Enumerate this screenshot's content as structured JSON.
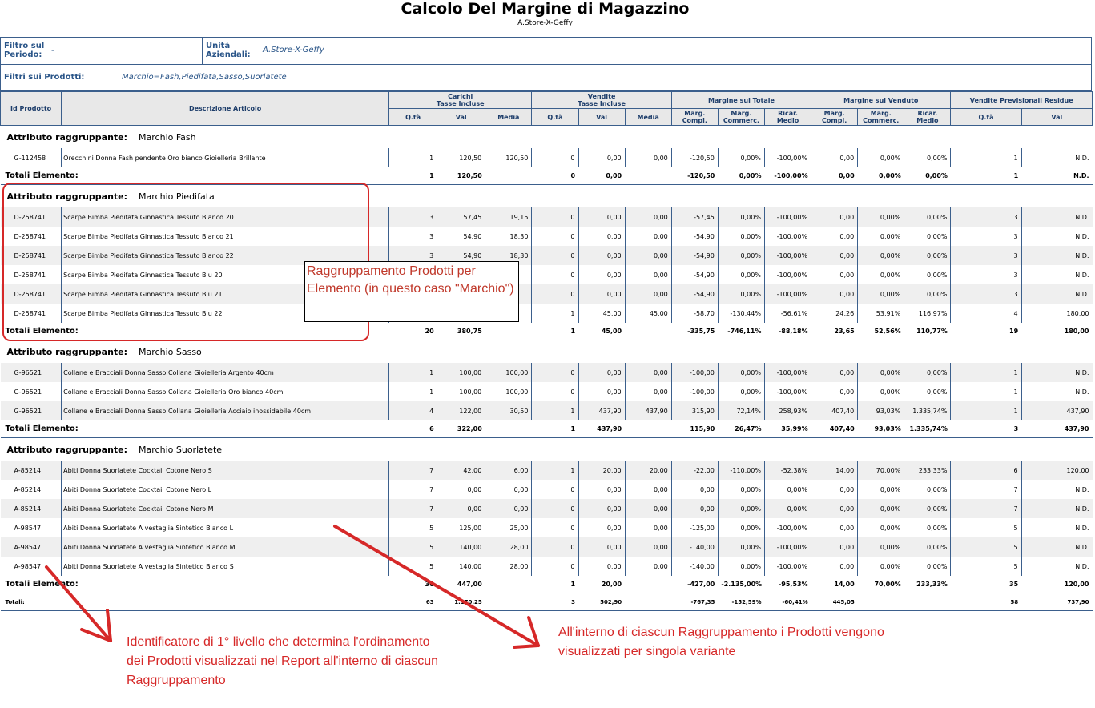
{
  "header": {
    "title": "Calcolo Del Margine di Magazzino",
    "subtitle": "A.Store-X-Geffy"
  },
  "filters": {
    "period_label": "Filtro sul Periodo:",
    "period_value": "-",
    "unit_label": "Unità Aziendali:",
    "unit_value": "A.Store-X-Geffy",
    "products_label": "Filtri sui Prodotti:",
    "products_value": "Marchio=Fash,Piedifata,Sasso,Suorlatete"
  },
  "columns": {
    "id": "Id Prodotto",
    "desc": "Descrizione Articolo",
    "carichi": "Carichi\nTasse Incluse",
    "vendite": "Vendite\nTasse Incluse",
    "marg_tot": "Margine sul Totale",
    "marg_vend": "Margine sul Venduto",
    "prev": "Vendite Previsionali Residue",
    "qta": "Q.tà",
    "val": "Val",
    "media": "Media",
    "marg_compl": "Marg.\nCompl.",
    "marg_comm": "Marg.\nCommerc.",
    "ricar": "Ricar. Medio"
  },
  "group_label": "Attributo raggruppante:",
  "totals_label": "Totali Elemento:",
  "grand_label": "Totali:",
  "groups": [
    {
      "name": "Marchio Fash",
      "rows": [
        [
          "G-112458",
          "Orecchini Donna Fash pendente Oro bianco Gioielleria Brillante",
          "1",
          "120,50",
          "120,50",
          "0",
          "0,00",
          "0,00",
          "-120,50",
          "0,00%",
          "-100,00%",
          "0,00",
          "0,00%",
          "0,00%",
          "1",
          "N.D."
        ]
      ],
      "total": [
        "1",
        "120,50",
        "",
        "0",
        "0,00",
        "",
        "-120,50",
        "0,00%",
        "-100,00%",
        "0,00",
        "0,00%",
        "0,00%",
        "1",
        "N.D."
      ]
    },
    {
      "name": "Marchio Piedifata",
      "rows": [
        [
          "D-258741",
          "Scarpe Bimba Piedifata Ginnastica Tessuto Bianco 20",
          "3",
          "57,45",
          "19,15",
          "0",
          "0,00",
          "0,00",
          "-57,45",
          "0,00%",
          "-100,00%",
          "0,00",
          "0,00%",
          "0,00%",
          "3",
          "N.D."
        ],
        [
          "D-258741",
          "Scarpe Bimba Piedifata Ginnastica Tessuto Bianco 21",
          "3",
          "54,90",
          "18,30",
          "0",
          "0,00",
          "0,00",
          "-54,90",
          "0,00%",
          "-100,00%",
          "0,00",
          "0,00%",
          "0,00%",
          "3",
          "N.D."
        ],
        [
          "D-258741",
          "Scarpe Bimba Piedifata Ginnastica Tessuto Bianco 22",
          "3",
          "54,90",
          "18,30",
          "0",
          "0,00",
          "0,00",
          "-54,90",
          "0,00%",
          "-100,00%",
          "0,00",
          "0,00%",
          "0,00%",
          "3",
          "N.D."
        ],
        [
          "D-258741",
          "Scarpe Bimba Piedifata Ginnastica Tessuto Blu 20",
          "",
          "",
          "",
          "0",
          "0,00",
          "0,00",
          "-54,90",
          "0,00%",
          "-100,00%",
          "0,00",
          "0,00%",
          "0,00%",
          "3",
          "N.D."
        ],
        [
          "D-258741",
          "Scarpe Bimba Piedifata Ginnastica Tessuto Blu 21",
          "",
          "",
          "",
          "0",
          "0,00",
          "0,00",
          "-54,90",
          "0,00%",
          "-100,00%",
          "0,00",
          "0,00%",
          "0,00%",
          "3",
          "N.D."
        ],
        [
          "D-258741",
          "Scarpe Bimba Piedifata Ginnastica Tessuto Blu 22",
          "",
          "",
          "",
          "1",
          "45,00",
          "45,00",
          "-58,70",
          "-130,44%",
          "-56,61%",
          "24,26",
          "53,91%",
          "116,97%",
          "4",
          "180,00"
        ]
      ],
      "total": [
        "20",
        "380,75",
        "",
        "1",
        "45,00",
        "",
        "-335,75",
        "-746,11%",
        "-88,18%",
        "23,65",
        "52,56%",
        "110,77%",
        "19",
        "180,00"
      ]
    },
    {
      "name": "Marchio Sasso",
      "rows": [
        [
          "G-96521",
          "Collane e Bracciali Donna Sasso Collana Gioielleria Argento 40cm",
          "1",
          "100,00",
          "100,00",
          "0",
          "0,00",
          "0,00",
          "-100,00",
          "0,00%",
          "-100,00%",
          "0,00",
          "0,00%",
          "0,00%",
          "1",
          "N.D."
        ],
        [
          "G-96521",
          "Collane e Bracciali Donna Sasso Collana Gioielleria Oro bianco 40cm",
          "1",
          "100,00",
          "100,00",
          "0",
          "0,00",
          "0,00",
          "-100,00",
          "0,00%",
          "-100,00%",
          "0,00",
          "0,00%",
          "0,00%",
          "1",
          "N.D."
        ],
        [
          "G-96521",
          "Collane e Bracciali Donna Sasso Collana Gioielleria Acciaio inossidabile 40cm",
          "4",
          "122,00",
          "30,50",
          "1",
          "437,90",
          "437,90",
          "315,90",
          "72,14%",
          "258,93%",
          "407,40",
          "93,03%",
          "1.335,74%",
          "1",
          "437,90"
        ]
      ],
      "total": [
        "6",
        "322,00",
        "",
        "1",
        "437,90",
        "",
        "115,90",
        "26,47%",
        "35,99%",
        "407,40",
        "93,03%",
        "1.335,74%",
        "3",
        "437,90"
      ]
    },
    {
      "name": "Marchio Suorlatete",
      "rows": [
        [
          "A-85214",
          "Abiti Donna Suorlatete Cocktail Cotone Nero S",
          "7",
          "42,00",
          "6,00",
          "1",
          "20,00",
          "20,00",
          "-22,00",
          "-110,00%",
          "-52,38%",
          "14,00",
          "70,00%",
          "233,33%",
          "6",
          "120,00"
        ],
        [
          "A-85214",
          "Abiti Donna Suorlatete Cocktail Cotone Nero L",
          "7",
          "0,00",
          "0,00",
          "0",
          "0,00",
          "0,00",
          "0,00",
          "0,00%",
          "0,00%",
          "0,00",
          "0,00%",
          "0,00%",
          "7",
          "N.D."
        ],
        [
          "A-85214",
          "Abiti Donna Suorlatete Cocktail Cotone Nero M",
          "7",
          "0,00",
          "0,00",
          "0",
          "0,00",
          "0,00",
          "0,00",
          "0,00%",
          "0,00%",
          "0,00",
          "0,00%",
          "0,00%",
          "7",
          "N.D."
        ],
        [
          "A-98547",
          "Abiti Donna Suorlatete A vestaglia Sintetico Bianco L",
          "5",
          "125,00",
          "25,00",
          "0",
          "0,00",
          "0,00",
          "-125,00",
          "0,00%",
          "-100,00%",
          "0,00",
          "0,00%",
          "0,00%",
          "5",
          "N.D."
        ],
        [
          "A-98547",
          "Abiti Donna Suorlatete A vestaglia Sintetico Bianco M",
          "5",
          "140,00",
          "28,00",
          "0",
          "0,00",
          "0,00",
          "-140,00",
          "0,00%",
          "-100,00%",
          "0,00",
          "0,00%",
          "0,00%",
          "5",
          "N.D."
        ],
        [
          "A-98547",
          "Abiti Donna Suorlatete A vestaglia Sintetico Bianco S",
          "5",
          "140,00",
          "28,00",
          "0",
          "0,00",
          "0,00",
          "-140,00",
          "0,00%",
          "-100,00%",
          "0,00",
          "0,00%",
          "0,00%",
          "5",
          "N.D."
        ]
      ],
      "total": [
        "36",
        "447,00",
        "",
        "1",
        "20,00",
        "",
        "-427,00",
        "-2.135,00%",
        "-95,53%",
        "14,00",
        "70,00%",
        "233,33%",
        "35",
        "120,00"
      ]
    }
  ],
  "grand_total": [
    "63",
    "1.170,25",
    "",
    "3",
    "502,90",
    "",
    "-767,35",
    "-152,59%",
    "-60,41%",
    "445,05",
    "",
    "",
    "58",
    "737,90"
  ],
  "annotations": {
    "callout": "Raggruppamento Prodotti per Elemento (in questo caso \"Marchio\")",
    "note_left": "Identificatore di 1° livello che determina l'ordinamento dei Prodotti visualizzati nel Report all'interno di ciascun Raggruppamento",
    "note_right": "All'interno di ciascun Raggruppamento i Prodotti vengono visualizzati per singola variante",
    "annotation_color": "#d62828"
  }
}
